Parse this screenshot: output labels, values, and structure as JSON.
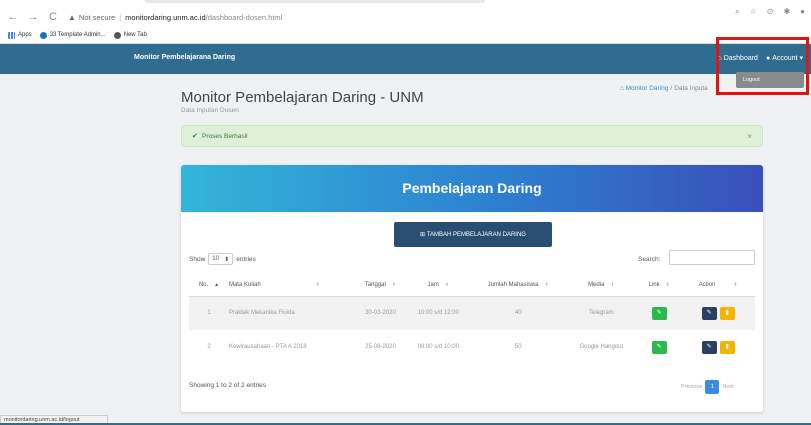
{
  "browser": {
    "back_icon": "←",
    "forward_icon": "→",
    "reload_icon": "C",
    "security_label": "Not secure",
    "url_domain": "monitordaring.unm.ac.id",
    "url_path": "/dashboard-dosen.html",
    "bookmarks": [
      "Apps",
      "33 Template Admin...",
      "New Tab"
    ]
  },
  "navbar": {
    "brand": "Monitor Pembelajarana Daring",
    "dashboard_label": "Dashboard",
    "account_label": "Account",
    "dropdown_item": "Logout",
    "color": "#2f6c8f"
  },
  "page": {
    "title": "Monitor Pembelajaran Daring - UNM",
    "subtitle": "Data Inputan Dosen",
    "breadcrumb_home": "Monitor Daring",
    "breadcrumb_sep": "/",
    "breadcrumb_current": "Data Inputa"
  },
  "alert": {
    "message": "Proses Berhasil",
    "close": "×"
  },
  "card": {
    "title": "Pembelajaran Daring",
    "add_button": "TAMBAH PEMBELAJARAN DARING",
    "show_label": "Show",
    "entries_value": "10",
    "entries_label": "entries",
    "search_label": "Search:",
    "columns": [
      "No.",
      "Mata Kuliah",
      "Tanggal",
      "Jam",
      "Jumlah Mahasiswa",
      "Media",
      "Link",
      "Action"
    ],
    "rows": [
      {
        "no": "1",
        "mata_kuliah": "Praktek Mekanika Fluida",
        "tanggal": "30-03-2020",
        "jam": "10:00 s/d 12:00",
        "jumlah": "40",
        "media": "Telegram"
      },
      {
        "no": "2",
        "mata_kuliah": "Kewirausahaan - PTA A 2018",
        "tanggal": "25-08-2020",
        "jam": "08:00 s/d 10:00",
        "jumlah": "50",
        "media": "Google Hangout"
      }
    ],
    "info": "Showing 1 to 2 of 2 entries",
    "previous": "Previous",
    "page": "1",
    "next": "Next"
  },
  "status_url": "monitordaring.unm.ac.id/logout"
}
